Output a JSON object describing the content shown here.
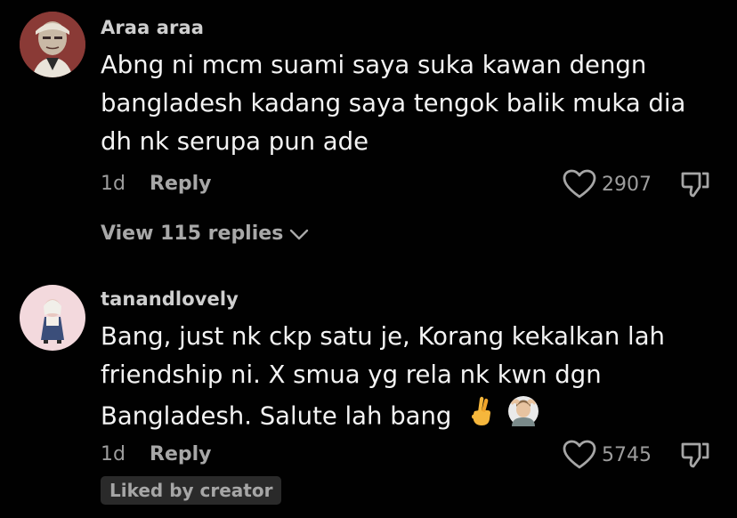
{
  "comments": [
    {
      "username": "Araa araa",
      "lines": [
        "Abng ni mcm suami saya suka kawan dengn",
        "bangladesh kadang saya tengok balik muka dia",
        "dh nk serupa pun ade"
      ],
      "time": "1d",
      "reply_label": "Reply",
      "likes": "2907",
      "view_replies": "View 115 replies"
    },
    {
      "username": "tanandlovely",
      "lines": [
        "Bang, just nk ckp satu je, Korang kekalkan lah",
        "friendship ni. X smua yg rela nk kwn dgn",
        "Bangladesh. Salute lah bang"
      ],
      "emojis": [
        "crossed-fingers-emoji",
        "person-gesturing-ok-emoji"
      ],
      "time": "1d",
      "reply_label": "Reply",
      "likes": "5745",
      "badge": "Liked by creator"
    }
  ],
  "colors": {
    "background": "#010101",
    "text": "#f3f3f3",
    "muted": "#9c9c9c",
    "badge_bg": "#2a2a2a"
  }
}
